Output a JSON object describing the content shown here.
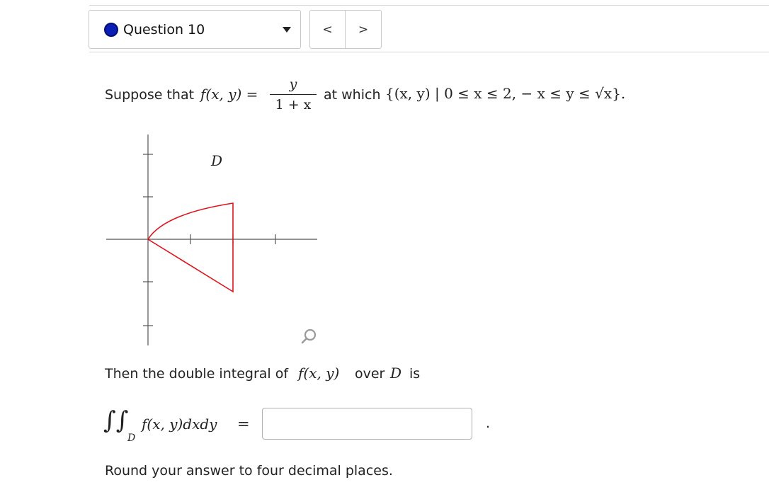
{
  "header": {
    "question_label": "Question 10",
    "prev_label": "<",
    "next_label": ">",
    "status_color": "#0a1fb5"
  },
  "problem": {
    "suppose_text": "Suppose that",
    "function_lhs": "f(x, y) =",
    "fraction_numerator": "y",
    "fraction_denominator": "1 + x",
    "at_which_text": "at which",
    "region_set": "{(x, y) | 0 ≤ x ≤ 2,  − x ≤ y ≤ √x}."
  },
  "graph": {
    "region_label": "D",
    "region_color": "#e0141e",
    "zoom_icon": "magnifier-icon"
  },
  "integral": {
    "intro_text_start": "Then the double integral of",
    "intro_function": "f(x, y)",
    "intro_text_mid": "over",
    "intro_region": "D",
    "intro_text_end": "is",
    "integral_sign": "∫∫",
    "subscript": "D",
    "integrand": "f(x, y)dxdy",
    "equals": "=",
    "answer_value": "",
    "trailing_period": "."
  },
  "instructions": {
    "rounding_text": "Round your answer to four decimal places."
  }
}
